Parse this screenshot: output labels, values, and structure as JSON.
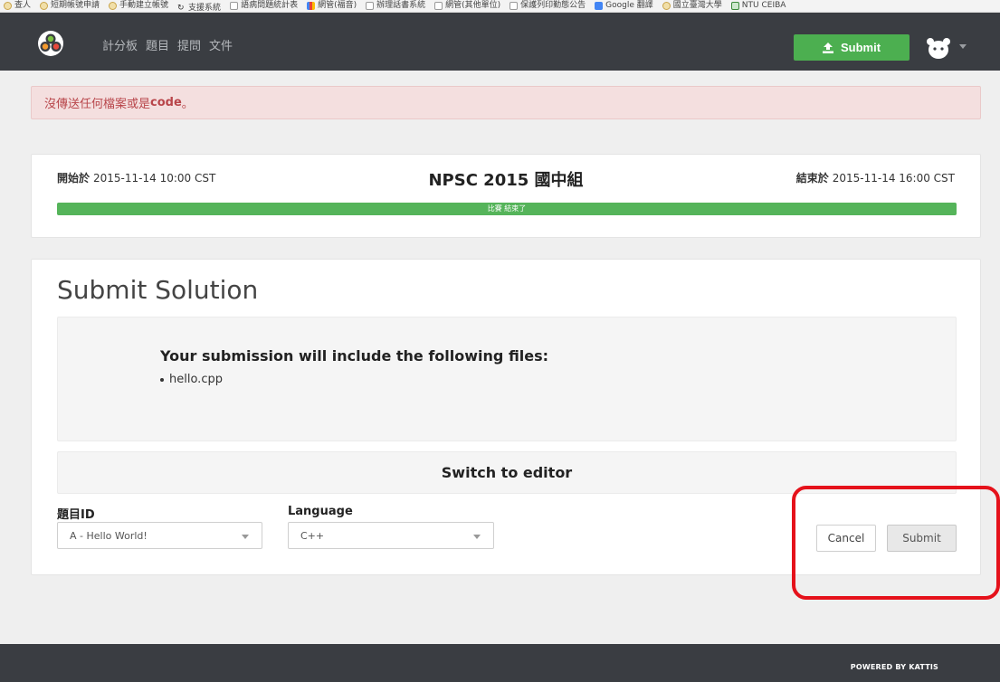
{
  "bookmarks": [
    {
      "label": "查人",
      "icon": "seal"
    },
    {
      "label": "短期帳號申請",
      "icon": "seal"
    },
    {
      "label": "手動建立帳號",
      "icon": "seal"
    },
    {
      "label": "支援系統",
      "icon": "arrow"
    },
    {
      "label": "語病問題統計表",
      "icon": "page"
    },
    {
      "label": "網管(福音)",
      "icon": "apps"
    },
    {
      "label": "辦理話書系統",
      "icon": "page"
    },
    {
      "label": "網管(其他單位)",
      "icon": "page"
    },
    {
      "label": "保護列印勤態公告",
      "icon": "page"
    },
    {
      "label": "Google 翻譯",
      "icon": "gtrans"
    },
    {
      "label": "國立臺灣大學",
      "icon": "seal"
    },
    {
      "label": "NTU CEIBA",
      "icon": "ceiba"
    }
  ],
  "navbar": {
    "links": [
      "計分板",
      "題目",
      "提問",
      "文件"
    ],
    "submit_label": "Submit"
  },
  "alert": {
    "text": "沒傳送任何檔案或是",
    "bold": "code",
    "suffix": "。"
  },
  "contest": {
    "start_label": "開始於",
    "start_time": "2015-11-14 10:00 CST",
    "title": "NPSC 2015 國中組",
    "end_label": "結束於",
    "end_time": "2015-11-14 16:00 CST",
    "progress_text": "比賽 結束了",
    "progress_fraction": 1.0
  },
  "submit": {
    "heading": "Submit Solution",
    "files_title": "Your submission will include the following files:",
    "files": [
      "hello.cpp"
    ],
    "switch_label": "Switch to editor",
    "problem_label": "題目ID",
    "problem_value": "A - Hello World!",
    "language_label": "Language",
    "language_value": "C++",
    "cancel_label": "Cancel",
    "submit_label": "Submit"
  },
  "footer": {
    "text": "POWERED BY KATTIS"
  },
  "colors": {
    "navbar": "#3a3d42",
    "accent_green": "#4caf50",
    "alert_bg": "#f4dfdf",
    "alert_text": "#b8454a",
    "annotation_red": "#e5121b"
  }
}
